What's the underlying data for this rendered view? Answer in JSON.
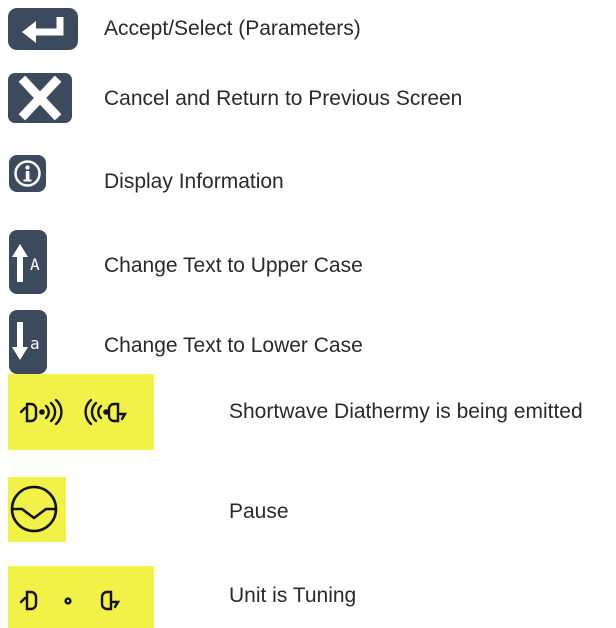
{
  "legend": {
    "items": [
      {
        "icon": "enter-arrow-icon",
        "label": "Accept/Select (Parameters)"
      },
      {
        "icon": "close-x-icon",
        "label": "Cancel and Return to Previous Screen"
      },
      {
        "icon": "info-icon",
        "label": "Display Information"
      },
      {
        "icon": "uppercase-arrow-icon",
        "label": "Change Text to Upper Case"
      },
      {
        "icon": "lowercase-arrow-icon",
        "label": "Change Text to Lower Case"
      },
      {
        "icon": "shortwave-emitting-icon",
        "label": "Shortwave Diathermy is being emitted"
      },
      {
        "icon": "pause-icon",
        "label": "Pause"
      },
      {
        "icon": "tuning-icon",
        "label": "Unit is Tuning"
      }
    ],
    "uppercase_glyph": "A",
    "lowercase_glyph": "a"
  },
  "colors": {
    "icon_dark": "#3b4a5c",
    "highlight_yellow": "#f1f148",
    "text": "#2a2a2a"
  }
}
